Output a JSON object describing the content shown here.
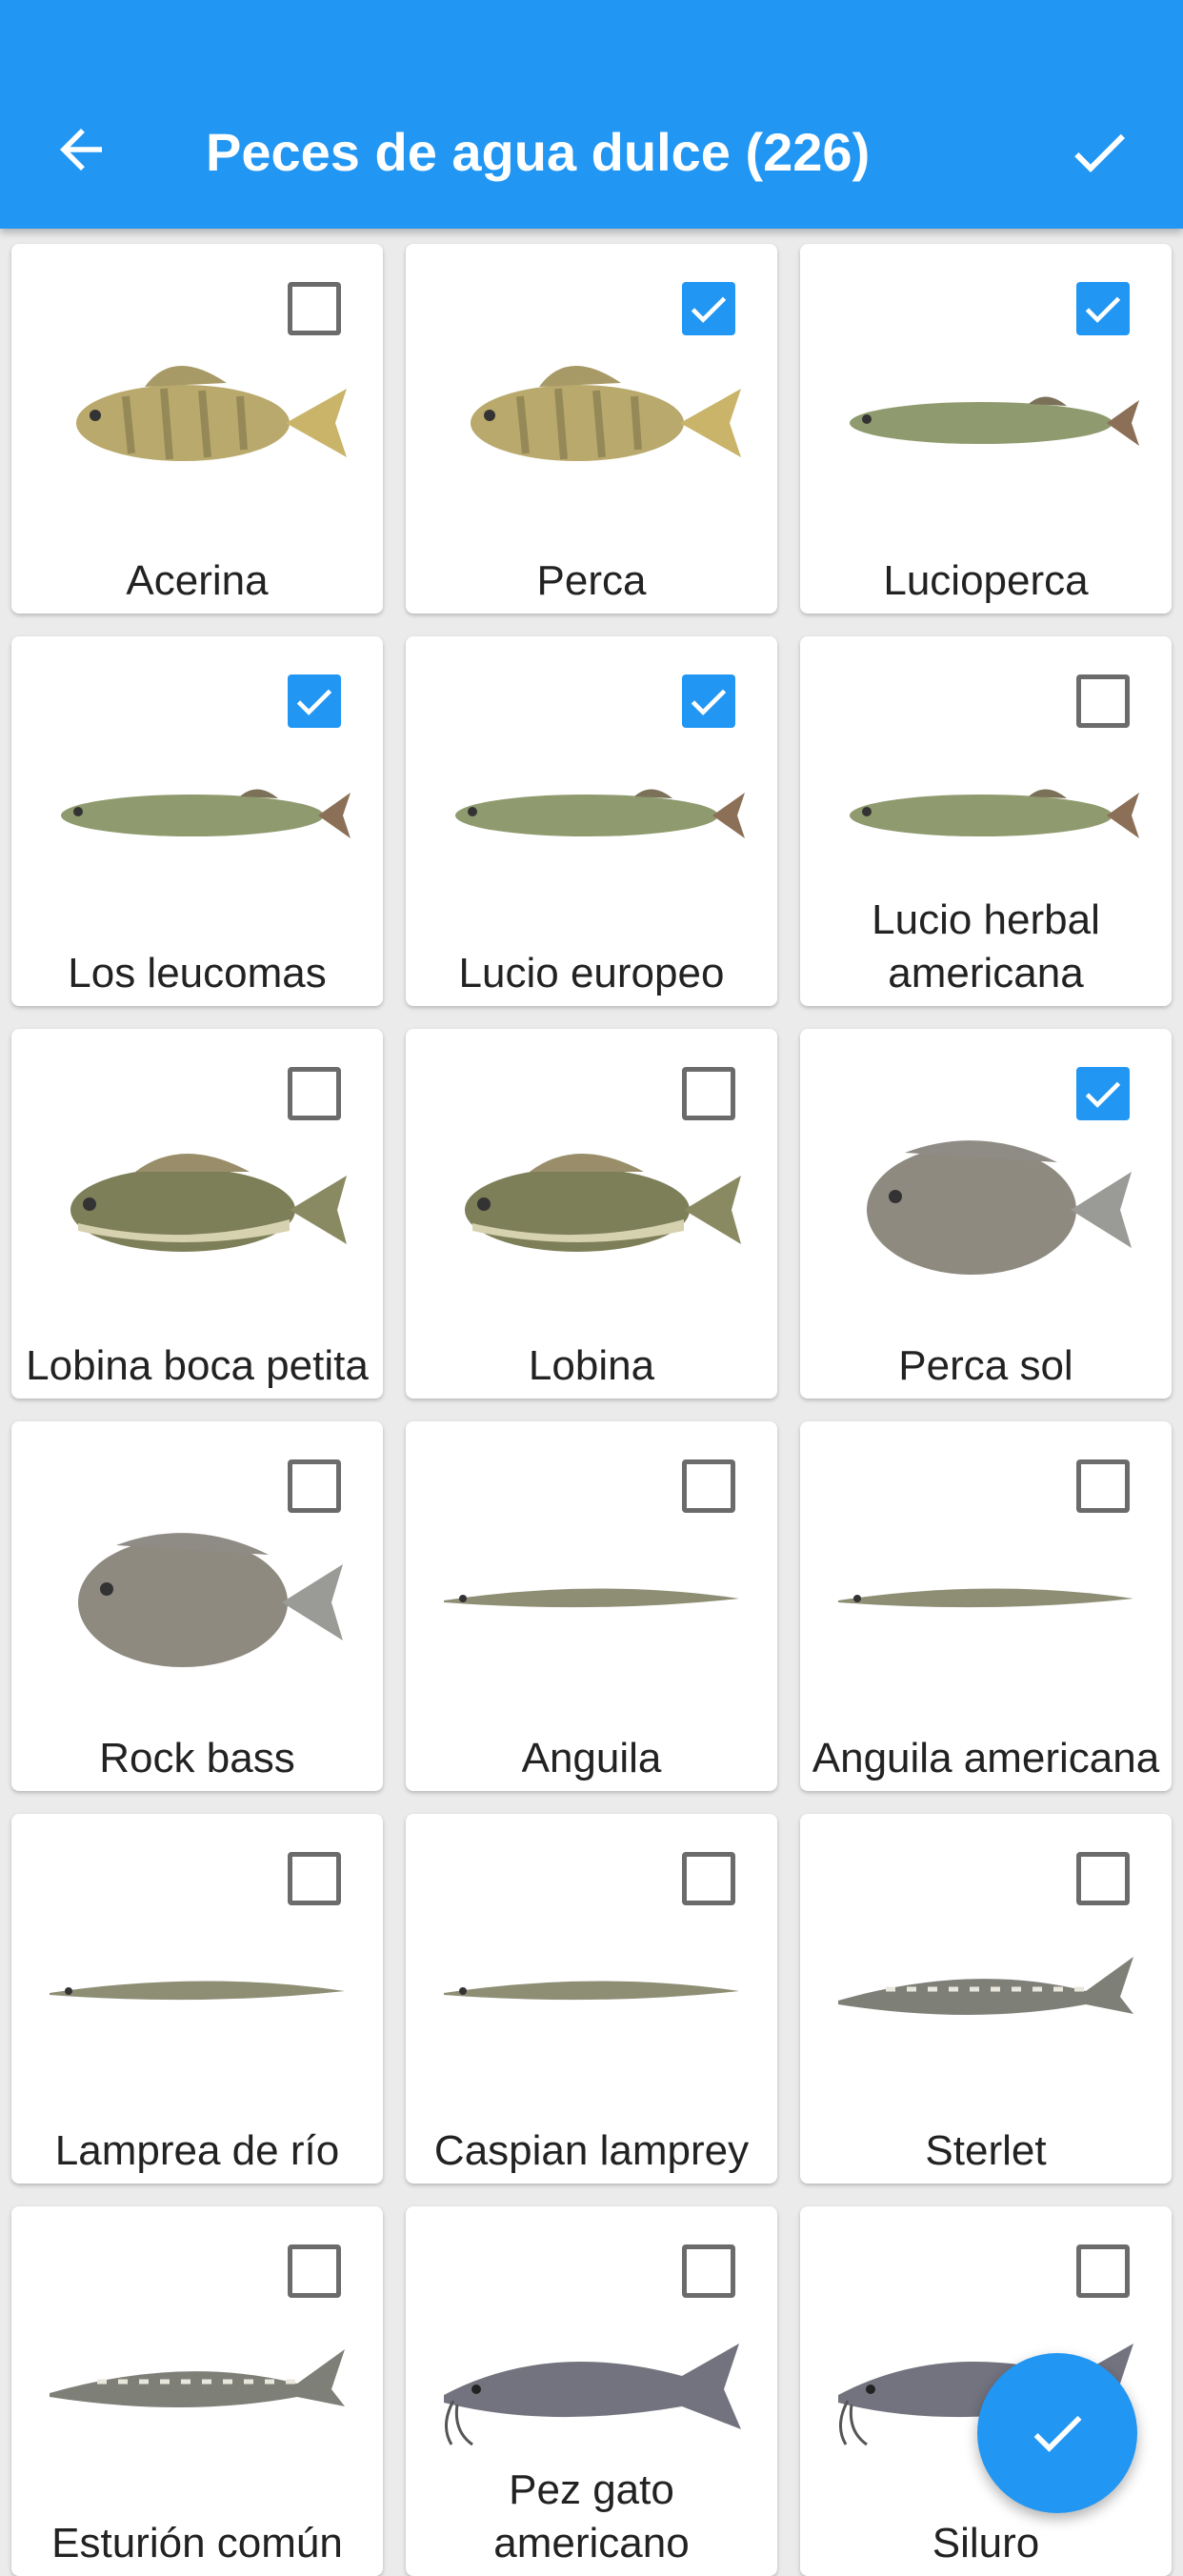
{
  "appbar": {
    "title": "Peces de agua dulce (226)",
    "back_icon": "arrow-left-icon",
    "confirm_icon": "check-icon"
  },
  "colors": {
    "primary": "#2196f3",
    "checkbox_off": "#6b6b6b"
  },
  "fish": [
    {
      "name": "Acerina",
      "checked": false,
      "shape": "perch"
    },
    {
      "name": "Perca",
      "checked": true,
      "shape": "perch"
    },
    {
      "name": "Lucioperca",
      "checked": true,
      "shape": "pike"
    },
    {
      "name": "Los leucomas",
      "checked": true,
      "shape": "pike"
    },
    {
      "name": "Lucio europeo",
      "checked": true,
      "shape": "pike"
    },
    {
      "name": "Lucio herbal americana",
      "checked": false,
      "shape": "pike"
    },
    {
      "name": "Lobina boca petita",
      "checked": false,
      "shape": "bass"
    },
    {
      "name": "Lobina",
      "checked": false,
      "shape": "bass"
    },
    {
      "name": "Perca sol",
      "checked": true,
      "shape": "sunfish"
    },
    {
      "name": "Rock bass",
      "checked": false,
      "shape": "sunfish"
    },
    {
      "name": "Anguila",
      "checked": false,
      "shape": "eel"
    },
    {
      "name": "Anguila americana",
      "checked": false,
      "shape": "eel"
    },
    {
      "name": "Lamprea de río",
      "checked": false,
      "shape": "eel"
    },
    {
      "name": "Caspian lamprey",
      "checked": false,
      "shape": "eel"
    },
    {
      "name": "Sterlet",
      "checked": false,
      "shape": "sturgeon"
    },
    {
      "name": "Esturión común",
      "checked": false,
      "shape": "sturgeon"
    },
    {
      "name": "Pez gato americano",
      "checked": false,
      "shape": "catfish"
    },
    {
      "name": "Siluro",
      "checked": false,
      "shape": "catfish"
    }
  ],
  "fab": {
    "icon": "check-icon"
  }
}
